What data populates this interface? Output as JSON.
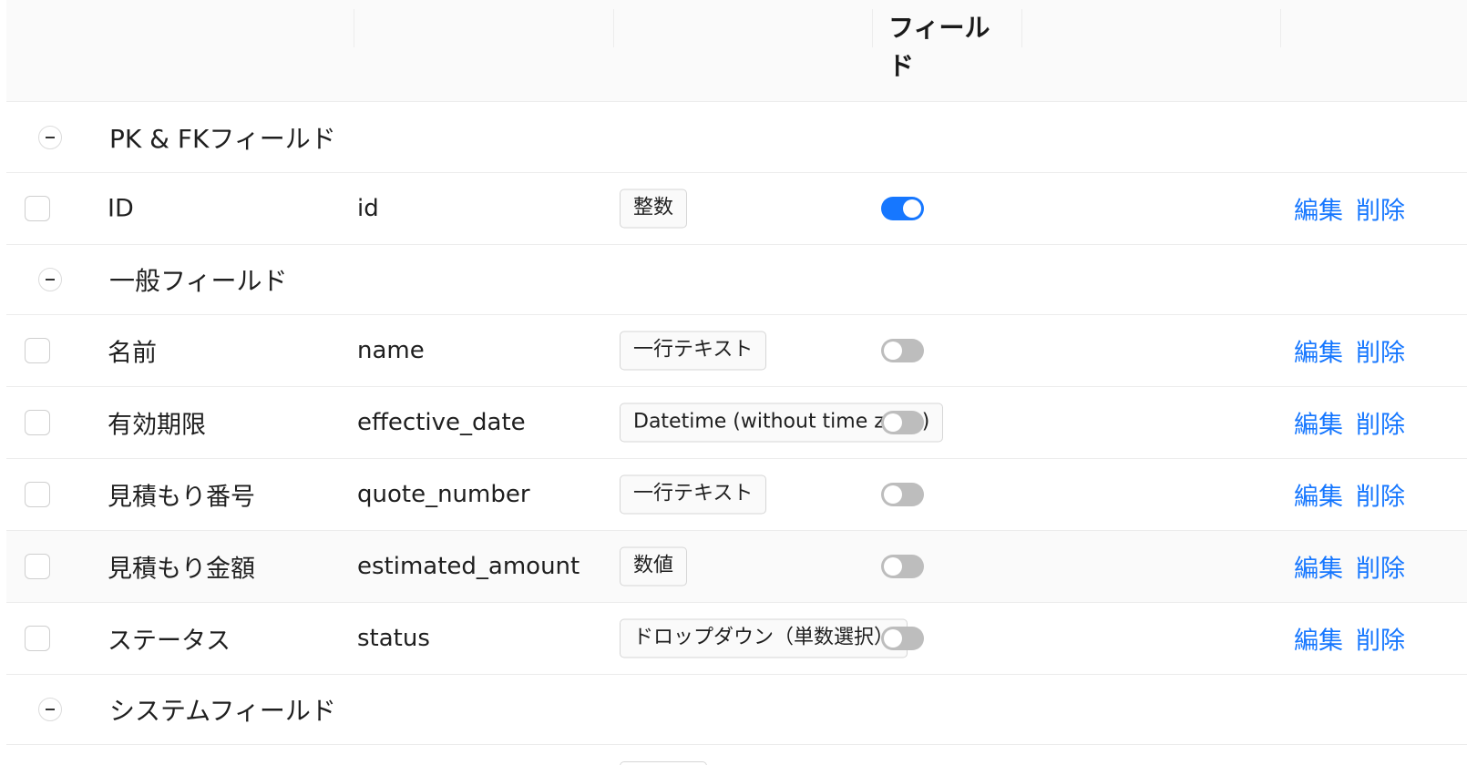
{
  "header": {
    "field_column": "フィールド"
  },
  "groups": [
    {
      "title": "PK & FKフィールド"
    },
    {
      "title": "一般フィールド"
    },
    {
      "title": "システムフィールド"
    }
  ],
  "rows": [
    {
      "label": "ID",
      "key": "id",
      "type": "整数",
      "toggle": "on"
    },
    {
      "label": "名前",
      "key": "name",
      "type": "一行テキスト",
      "toggle": "off"
    },
    {
      "label": "有効期限",
      "key": "effective_date",
      "type": "Datetime (without time zone)",
      "toggle": "off"
    },
    {
      "label": "見積もり番号",
      "key": "quote_number",
      "type": "一行テキスト",
      "toggle": "off"
    },
    {
      "label": "見積もり金額",
      "key": "estimated_amount",
      "type": "数値",
      "toggle": "off"
    },
    {
      "label": "ステータス",
      "key": "status",
      "type": "ドロップダウン（単数選択）",
      "toggle": "off"
    }
  ],
  "actions": {
    "edit": "編集",
    "delete": "削除"
  },
  "colors": {
    "link": "#1677ff",
    "toggle_on": "#1677ff",
    "toggle_off": "#bdbdbd"
  }
}
